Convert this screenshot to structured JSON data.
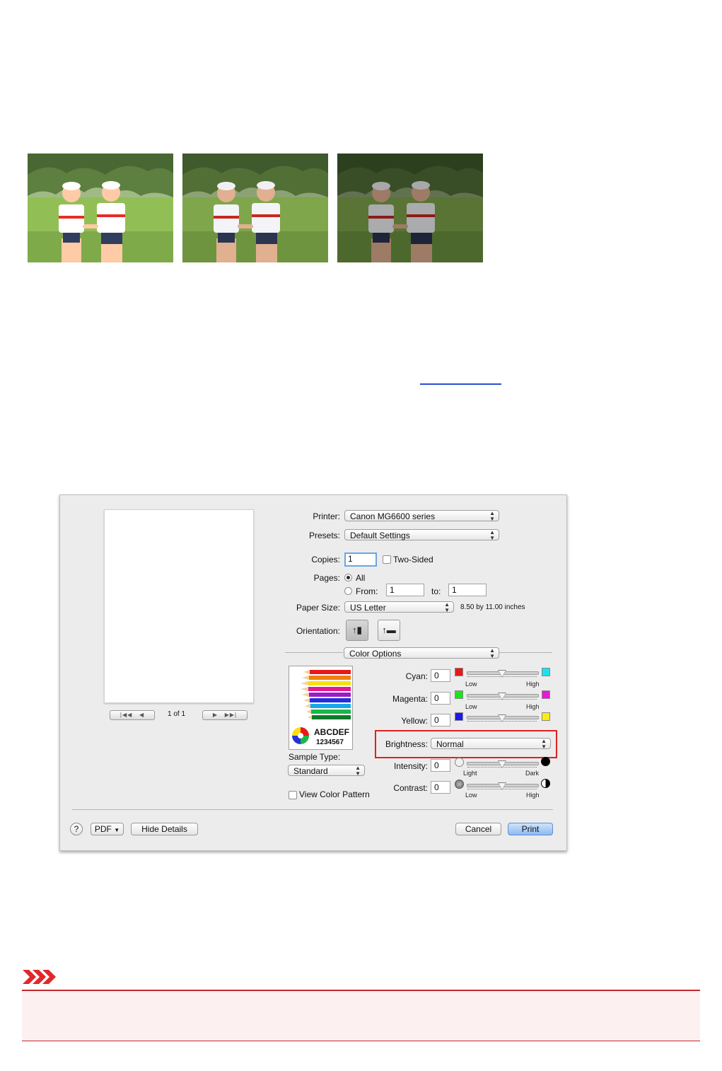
{
  "photos": [
    {
      "name": "photo-light",
      "tone": 1.15
    },
    {
      "name": "photo-normal",
      "tone": 1.0
    },
    {
      "name": "photo-dark",
      "tone": 0.7
    }
  ],
  "dialog": {
    "printer_label": "Printer:",
    "printer_value": "Canon MG6600 series",
    "presets_label": "Presets:",
    "presets_value": "Default Settings",
    "copies_label": "Copies:",
    "copies_value": "1",
    "two_sided_label": "Two-Sided",
    "pages_label": "Pages:",
    "pages_all_label": "All",
    "pages_from_label": "From:",
    "pages_from_value": "1",
    "pages_to_label": "to:",
    "pages_to_value": "1",
    "paper_size_label": "Paper Size:",
    "paper_size_value": "US Letter",
    "paper_size_dims": "8.50 by 11.00 inches",
    "orientation_label": "Orientation:",
    "section_value": "Color Options",
    "pager_text": "1 of 1",
    "sample_abc": "ABCDEF",
    "sample_num": "1234567",
    "sample_type_label": "Sample Type:",
    "sample_type_value": "Standard",
    "view_color_pattern_label": "View Color Pattern",
    "cyan_label": "Cyan:",
    "cyan_value": "0",
    "magenta_label": "Magenta:",
    "magenta_value": "0",
    "yellow_label": "Yellow:",
    "yellow_value": "0",
    "brightness_label": "Brightness:",
    "brightness_value": "Normal",
    "intensity_label": "Intensity:",
    "intensity_value": "0",
    "contrast_label": "Contrast:",
    "contrast_value": "0",
    "low": "Low",
    "high": "High",
    "light": "Light",
    "dark": "Dark",
    "help_label": "?",
    "pdf_label": "PDF",
    "hide_details_label": "Hide Details",
    "cancel_label": "Cancel",
    "print_label": "Print"
  },
  "colors": {
    "cyan": "#19e3ea",
    "magenta": "#e619d6",
    "yellow": "#f7ee10",
    "red": "#e81818",
    "green": "#19e619",
    "blue": "#1a1ae8",
    "highlight": "#e02020",
    "important": "#c0282d"
  }
}
